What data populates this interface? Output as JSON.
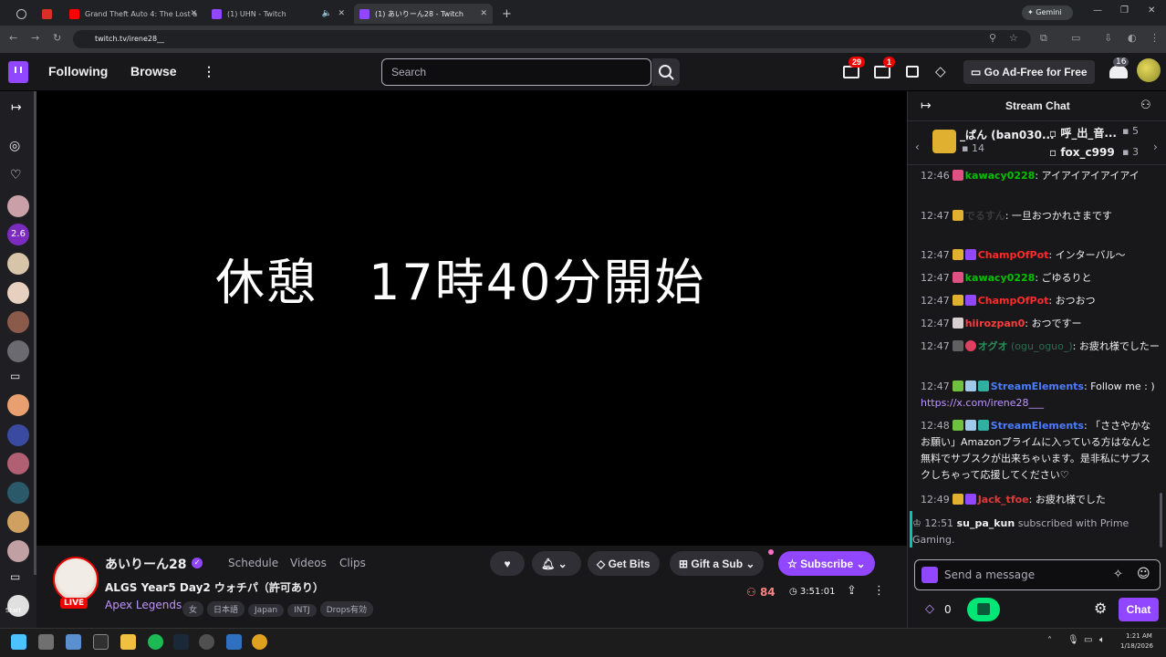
{
  "browser": {
    "tabs": [
      {
        "label": "Grand Theft Auto 4: The Lost a"
      },
      {
        "label": "(1) UHN - Twitch"
      },
      {
        "label": "(1) あいりーん28 - Twitch"
      }
    ],
    "gemini_label": "Gemini",
    "url": "twitch.tv/irene28__"
  },
  "nav": {
    "following": "Following",
    "browse": "Browse",
    "search_placeholder": "Search",
    "notifications_count": "29",
    "inbox_count": "1",
    "ad_free": "Go Ad-Free for Free",
    "bits_count": "16"
  },
  "sidebar": {
    "viewer_badge": "2.6",
    "start": "Start"
  },
  "video": {
    "overlay_text": "休憩　17時40分開始"
  },
  "stream": {
    "channel": "あいりーん28",
    "links": [
      "Schedule",
      "Videos",
      "Clips"
    ],
    "title": "ALGS Year5 Day2 ウォチパ（許可あり）",
    "live": "LIVE",
    "game": "Apex Legends",
    "tags": [
      "女",
      "日本語",
      "Japan",
      "INTJ",
      "Drops有効"
    ],
    "viewers": "84",
    "uptime": "3:51:01",
    "get_bits": "Get Bits",
    "gift_sub": "Gift a Sub",
    "subscribe": "Subscribe"
  },
  "chat": {
    "title": "Stream Chat",
    "gifters": [
      {
        "name": "_ぱん (ban030...",
        "count": "14"
      },
      {
        "name": "呼_出_音...",
        "count": "5"
      },
      {
        "name": "fox_c999",
        "count": "3"
      }
    ],
    "messages": [
      {
        "time": "12:46",
        "user": "kawacy0228",
        "color": "#00c000",
        "text": ": アイアイアイアイアイ"
      },
      {
        "time": "12:47",
        "user": "でるすん",
        "color": "#3a3a3a",
        "text": ": 一旦おつかれさまです"
      },
      {
        "time": "12:47",
        "user": "ChampOfPot",
        "color": "#ff2a2a",
        "text": ": インターバル〜"
      },
      {
        "time": "12:47",
        "user": "kawacy0228",
        "color": "#00c000",
        "text": ": ごゆるりと"
      },
      {
        "time": "12:47",
        "user": "ChampOfPot",
        "color": "#ff2a2a",
        "text": ": おつおつ"
      },
      {
        "time": "12:47",
        "user": "hiirozpan0",
        "color": "#ff3b3b",
        "text": ": おつですー"
      },
      {
        "time": "12:47",
        "user": "オグオ",
        "extra": "(ogu_oguo_)",
        "color": "#2e8b57",
        "text": ": お疲れ様でしたー"
      },
      {
        "time": "12:47",
        "user": "StreamElements",
        "color": "#4a7dff",
        "text": ": Follow me : ) ",
        "link": "https://x.com/irene28___"
      },
      {
        "time": "12:48",
        "user": "StreamElements",
        "color": "#4a7dff",
        "text": ": 「ささやかなお願い」Amazonプライムに入っている方はなんと無料でサブスクが出来ちゃいます。是非私にサブスクしちゃって応援してください♡"
      },
      {
        "time": "12:49",
        "user": "Jack_tfoe",
        "color": "#e03a3a",
        "text": ": お疲れ様でした"
      }
    ],
    "sub_notice": {
      "time": "12:51",
      "user": "su_pa_kun",
      "text": " subscribed with Prime Gaming."
    },
    "input_placeholder": "Send a message",
    "points": "0",
    "chat_button": "Chat"
  },
  "taskbar": {
    "time": "1:21 AM",
    "date": "1/18/2026"
  }
}
